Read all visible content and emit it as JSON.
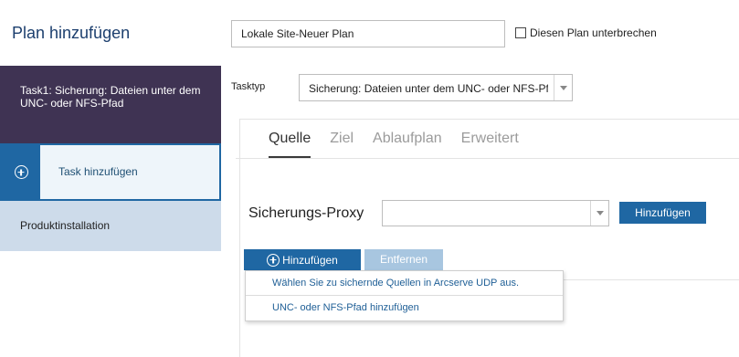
{
  "header": {
    "title": "Plan hinzufügen",
    "plan_name_value": "Lokale Site-Neuer Plan",
    "pause_label": "Diesen Plan unterbrechen"
  },
  "sidebar": {
    "active_task": "Task1: Sicherung: Dateien unter dem UNC- oder NFS-Pfad",
    "add_task": "Task hinzufügen",
    "product_install": "Produktinstallation"
  },
  "task": {
    "type_label": "Tasktyp",
    "type_value": "Sicherung: Dateien unter dem UNC- oder NFS-Pfad"
  },
  "tabs": [
    {
      "label": "Quelle",
      "active": true
    },
    {
      "label": "Ziel",
      "active": false
    },
    {
      "label": "Ablaufplan",
      "active": false
    },
    {
      "label": "Erweitert",
      "active": false
    }
  ],
  "source": {
    "proxy_label": "Sicherungs-Proxy",
    "proxy_value": "",
    "proxy_add_button": "Hinzufügen",
    "add_button": "Hinzufügen",
    "remove_button": "Entfernen"
  },
  "add_menu": {
    "items": [
      "Wählen Sie zu sichernde Quellen in Arcserve UDP aus.",
      "UNC- oder NFS-Pfad hinzufügen"
    ]
  },
  "colors": {
    "primary": "#1f67a3",
    "sidebar_active": "#3f3353",
    "sidebar_secondary": "#cddbea",
    "disabled_button": "#a8c6e0"
  }
}
